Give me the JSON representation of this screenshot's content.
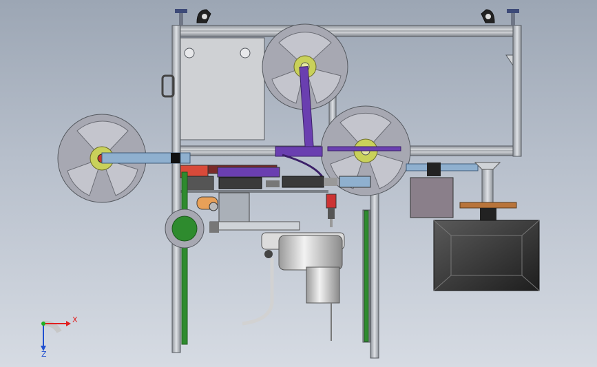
{
  "viewport": {
    "background_top": "#9ca6b4",
    "background_bottom": "#d6dbe3"
  },
  "colors": {
    "frame": "#b9bec6",
    "frame_edge": "#55595f",
    "panel": "#cfd1d4",
    "reel": "#9a9ba5",
    "hub": "#c9d15a",
    "arm_blue": "#8fb0cf",
    "arm_purple": "#6a3fb0",
    "green_rail": "#2e8b2e",
    "dark_box": "#3a3a3a",
    "bronze": "#b8743a"
  },
  "triad": {
    "x_label": "X",
    "z_label": "Z",
    "x_color": "#e02020",
    "z_color": "#2050d0",
    "y_color": "#20b020"
  }
}
